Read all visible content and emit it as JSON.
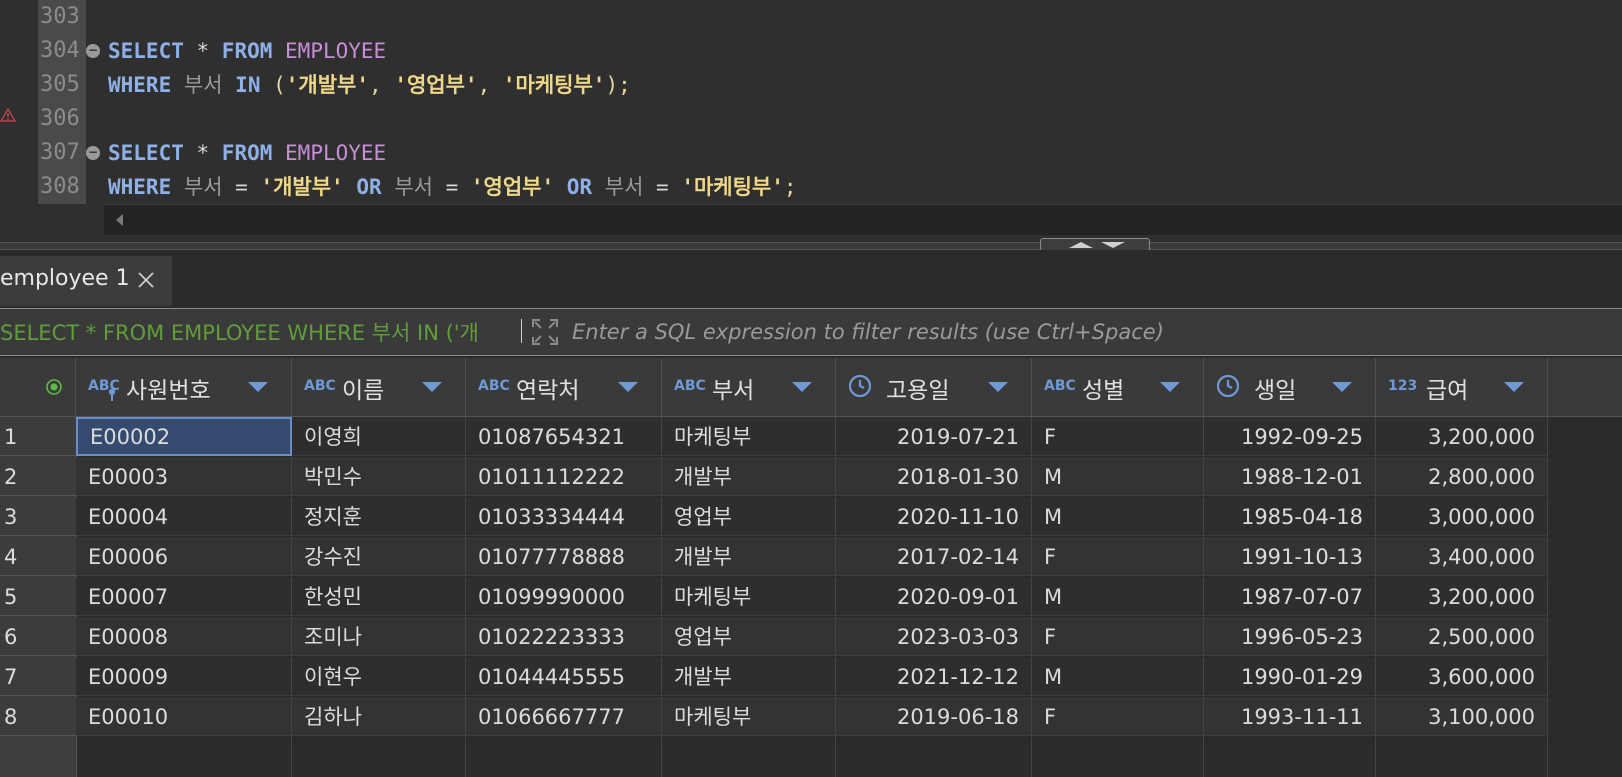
{
  "editor": {
    "lines": [
      {
        "num": "303",
        "tokens": []
      },
      {
        "num": "304",
        "fold": "⊖",
        "tokens": [
          {
            "t": "SELECT",
            "c": "kw"
          },
          {
            "t": " * ",
            "c": "op"
          },
          {
            "t": "FROM",
            "c": "kw"
          },
          {
            "t": " ",
            "c": "op"
          },
          {
            "t": "EMPLOYEE",
            "c": "tbl"
          }
        ]
      },
      {
        "num": "305",
        "tokens": [
          {
            "t": "WHERE",
            "c": "kw"
          },
          {
            "t": " ",
            "c": "op"
          },
          {
            "t": "부서",
            "c": "col"
          },
          {
            "t": " ",
            "c": "op"
          },
          {
            "t": "IN",
            "c": "kw"
          },
          {
            "t": " (",
            "c": "pun"
          },
          {
            "t": "'개발부'",
            "c": "str"
          },
          {
            "t": ", ",
            "c": "pun"
          },
          {
            "t": "'영업부'",
            "c": "str"
          },
          {
            "t": ", ",
            "c": "pun"
          },
          {
            "t": "'마케팅부'",
            "c": "str"
          },
          {
            "t": ");",
            "c": "pun"
          }
        ]
      },
      {
        "num": "306",
        "tokens": []
      },
      {
        "num": "307",
        "fold": "⊖",
        "tokens": [
          {
            "t": "SELECT",
            "c": "kw"
          },
          {
            "t": " * ",
            "c": "op"
          },
          {
            "t": "FROM",
            "c": "kw"
          },
          {
            "t": " ",
            "c": "op"
          },
          {
            "t": "EMPLOYEE",
            "c": "tbl"
          }
        ]
      },
      {
        "num": "308",
        "tokens": [
          {
            "t": "WHERE",
            "c": "kw"
          },
          {
            "t": " ",
            "c": "op"
          },
          {
            "t": "부서",
            "c": "col"
          },
          {
            "t": " = ",
            "c": "op"
          },
          {
            "t": "'개발부'",
            "c": "str"
          },
          {
            "t": " ",
            "c": "op"
          },
          {
            "t": "OR",
            "c": "kw"
          },
          {
            "t": " ",
            "c": "op"
          },
          {
            "t": "부서",
            "c": "col"
          },
          {
            "t": " = ",
            "c": "op"
          },
          {
            "t": "'영업부'",
            "c": "str"
          },
          {
            "t": " ",
            "c": "op"
          },
          {
            "t": "OR",
            "c": "kw"
          },
          {
            "t": " ",
            "c": "op"
          },
          {
            "t": "부서",
            "c": "col"
          },
          {
            "t": " = ",
            "c": "op"
          },
          {
            "t": "'마케팅부'",
            "c": "str"
          },
          {
            "t": ";",
            "c": "pun"
          }
        ]
      }
    ]
  },
  "results": {
    "tab_label": "employee 1",
    "filter_query": "SELECT * FROM EMPLOYEE WHERE 부서 IN ('개",
    "filter_placeholder": "Enter a SQL expression to filter results (use Ctrl+Space)",
    "columns": [
      {
        "type": "ABC",
        "name": "사원번호",
        "key": true
      },
      {
        "type": "ABC",
        "name": "이름"
      },
      {
        "type": "ABC",
        "name": "연락처"
      },
      {
        "type": "clock",
        "name": "부서",
        "type_label": "ABC"
      },
      {
        "type": "clock",
        "name": "고용일"
      },
      {
        "type": "ABC",
        "name": "성별"
      },
      {
        "type": "clock",
        "name": "생일"
      },
      {
        "type": "123",
        "name": "급여"
      }
    ],
    "rows": [
      {
        "n": "1",
        "cells": [
          "E00002",
          "이영희",
          "01087654321",
          "마케팅부",
          "2019-07-21",
          "F",
          "1992-09-25",
          "3,200,000"
        ]
      },
      {
        "n": "2",
        "cells": [
          "E00003",
          "박민수",
          "01011112222",
          "개발부",
          "2018-01-30",
          "M",
          "1988-12-01",
          "2,800,000"
        ]
      },
      {
        "n": "3",
        "cells": [
          "E00004",
          "정지훈",
          "01033334444",
          "영업부",
          "2020-11-10",
          "M",
          "1985-04-18",
          "3,000,000"
        ]
      },
      {
        "n": "4",
        "cells": [
          "E00006",
          "강수진",
          "01077778888",
          "개발부",
          "2017-02-14",
          "F",
          "1991-10-13",
          "3,400,000"
        ]
      },
      {
        "n": "5",
        "cells": [
          "E00007",
          "한성민",
          "01099990000",
          "마케팅부",
          "2020-09-01",
          "M",
          "1987-07-07",
          "3,200,000"
        ]
      },
      {
        "n": "6",
        "cells": [
          "E00008",
          "조미나",
          "01022223333",
          "영업부",
          "2023-03-03",
          "F",
          "1996-05-23",
          "2,500,000"
        ]
      },
      {
        "n": "7",
        "cells": [
          "E00009",
          "이현우",
          "01044445555",
          "개발부",
          "2021-12-12",
          "M",
          "1990-01-29",
          "3,600,000"
        ]
      },
      {
        "n": "8",
        "cells": [
          "E00010",
          "김하나",
          "01066667777",
          "마케팅부",
          "2019-06-18",
          "F",
          "1993-11-11",
          "3,100,000"
        ]
      }
    ]
  },
  "colors": {
    "accent": "#6f9ad6",
    "selection": "#344a6e",
    "query_green": "#5f9e3b"
  }
}
